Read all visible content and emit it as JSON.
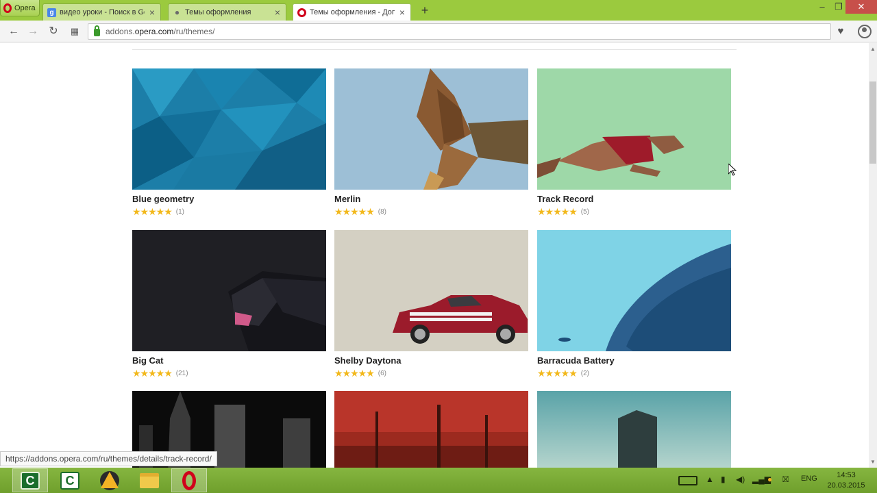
{
  "browser": {
    "menu_label": "Opera",
    "tabs": [
      {
        "title": "видео уроки - Поиск в Google",
        "icon": "google-icon",
        "active": false
      },
      {
        "title": "Темы оформления",
        "icon": "theme-drop-icon",
        "active": false
      },
      {
        "title": "Темы оформления - Дополнения",
        "icon": "opera-icon",
        "active": true
      }
    ],
    "new_tab_label": "+",
    "url_host_prefix": "addons.",
    "url_host": "opera.com",
    "url_path": "/ru/themes/",
    "status_url": "https://addons.opera.com/ru/themes/details/track-record/"
  },
  "themes": [
    {
      "name": "Blue geometry",
      "count": "(1)",
      "stars": 4.5
    },
    {
      "name": "Merlin",
      "count": "(8)",
      "stars": 4.5
    },
    {
      "name": "Track Record",
      "count": "(5)",
      "stars": 4.5
    },
    {
      "name": "Big Cat",
      "count": "(21)",
      "stars": 4.5
    },
    {
      "name": "Shelby Daytona",
      "count": "(6)",
      "stars": 4.5
    },
    {
      "name": "Barracuda Battery",
      "count": "(2)",
      "stars": 4.5
    },
    {
      "name": "",
      "count": "",
      "stars": 0
    },
    {
      "name": "",
      "count": "",
      "stars": 0
    },
    {
      "name": "",
      "count": "",
      "stars": 0
    }
  ],
  "taskbar": {
    "apps": [
      "camtasia-recorder-icon",
      "camtasia-studio-icon",
      "aimp-icon",
      "file-explorer-icon",
      "opera-icon"
    ],
    "language": "ENG",
    "time": "14:53",
    "date": "20.03.2015"
  },
  "colors": {
    "titlebar": "#9bca3e",
    "taskbar": "#7aa935",
    "star": "#f2b81b"
  }
}
